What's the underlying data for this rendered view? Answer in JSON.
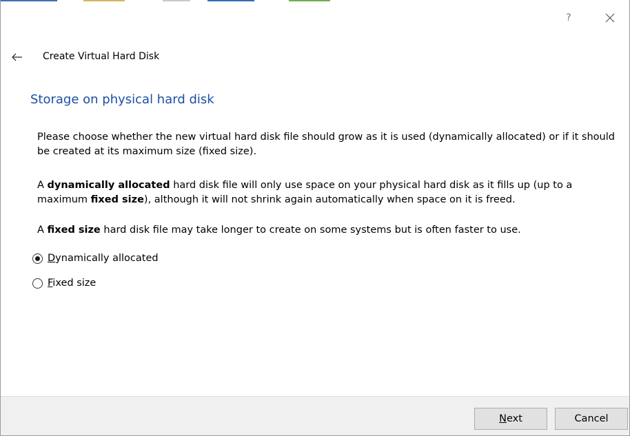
{
  "titlebar": {
    "help_icon_glyph": "?",
    "help_icon": "question-mark-icon",
    "close_icon": "close-icon"
  },
  "wizard": {
    "back_icon": "back-arrow-icon",
    "title": "Create Virtual Hard Disk"
  },
  "page": {
    "heading": "Storage on physical hard disk",
    "para1": "Please choose whether the new virtual hard disk file should grow as it is used (dynamically allocated) or if it should be created at its maximum size (fixed size).",
    "para2": {
      "part1": "A ",
      "bold1": "dynamically allocated",
      "part2": " hard disk file will only use space on your physical hard disk as it fills up (up to a maximum ",
      "bold2": "fixed size",
      "part3": "), although it will not shrink again automatically when space on it is freed."
    },
    "para3": {
      "part1": "A ",
      "bold1": "fixed size",
      "part2": " hard disk file may take longer to create on some systems but is often faster to use."
    }
  },
  "options": [
    {
      "mnemonic": "D",
      "label_rest": "ynamically allocated",
      "selected": true
    },
    {
      "mnemonic": "F",
      "label_rest": "ixed size",
      "selected": false
    }
  ],
  "footer": {
    "next_mnemonic": "N",
    "next_rest": "ext",
    "cancel_label": "Cancel"
  },
  "colors": {
    "heading": "#1b4fa6",
    "footer_bg": "#f0f0f0",
    "button_bg": "#e1e1e1",
    "button_border": "#adadad"
  }
}
